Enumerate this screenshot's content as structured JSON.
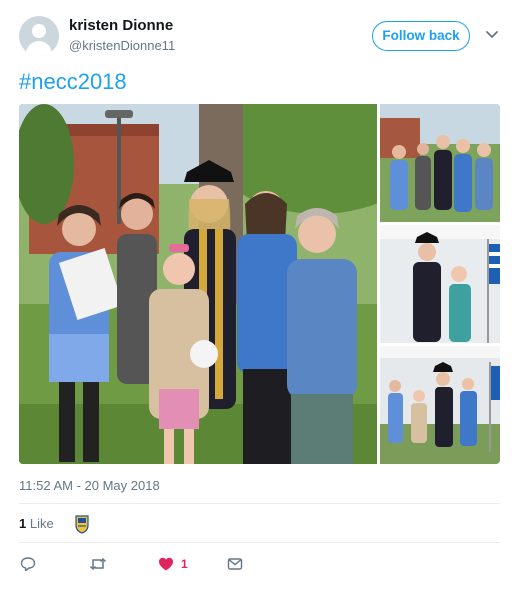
{
  "user": {
    "display_name": "kristen Dionne",
    "handle": "@kristenDionne11",
    "avatar_icon": "default-profile-icon"
  },
  "follow_button_label": "Follow back",
  "menu_icon": "chevron-down-icon",
  "tweet_text": "#necc2018",
  "media": {
    "main_photo_alt": "group photo",
    "thumbnails": [
      "group photo",
      "graduate and child",
      "group under tent"
    ]
  },
  "timestamp": "11:52 AM - 20 May 2018",
  "likes": {
    "count": "1",
    "label": "Like"
  },
  "actions": {
    "reply_icon": "reply-icon",
    "retweet_icon": "retweet-icon",
    "like_icon": "heart-icon",
    "like_count": "1",
    "dm_icon": "envelope-icon"
  },
  "colors": {
    "accent": "#1da1f2",
    "like": "#e0245e",
    "muted": "#657786"
  }
}
